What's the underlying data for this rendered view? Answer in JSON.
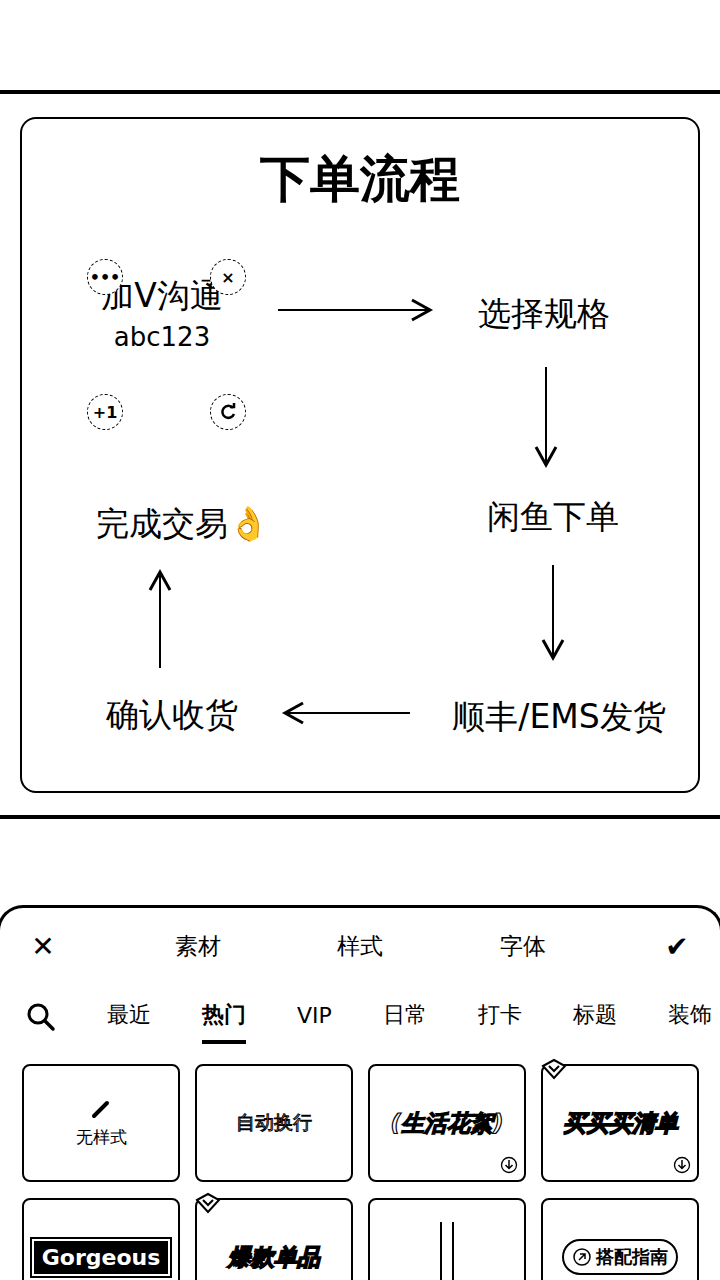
{
  "card": {
    "title": "下单流程",
    "nodes": [
      {
        "label": "加V沟通",
        "sub": "abc123",
        "selected": true
      },
      {
        "label": "选择规格",
        "selected": false
      },
      {
        "label": "闲鱼下单",
        "selected": false
      },
      {
        "label": "顺丰/EMS发货",
        "selected": false
      },
      {
        "label": "确认收货",
        "selected": false
      },
      {
        "label": "完成交易👌",
        "selected": false
      }
    ],
    "handles": [
      "•••",
      "×",
      "+1"
    ]
  },
  "toolbar": {
    "cancel": "✕",
    "tabs": [
      "素材",
      "样式",
      "字体"
    ],
    "confirm": "✔"
  },
  "categories": [
    {
      "label": "最近",
      "selected": false
    },
    {
      "label": "热门",
      "selected": true
    },
    {
      "label": "VIP",
      "selected": false
    },
    {
      "label": "日常",
      "selected": false
    },
    {
      "label": "打卡",
      "selected": false
    },
    {
      "label": "标题",
      "selected": false
    },
    {
      "label": "装饰",
      "selected": false
    }
  ],
  "styles": [
    {
      "label": "无样式",
      "kind": "none",
      "vip": false,
      "download": false
    },
    {
      "label": "自动换行",
      "kind": "outline",
      "vip": false,
      "download": false
    },
    {
      "label": "(生活花絮)",
      "kind": "italic",
      "vip": false,
      "download": true
    },
    {
      "label": "买买买清单",
      "kind": "heavy",
      "vip": true,
      "download": true
    },
    {
      "label": "Gorgeous",
      "kind": "boxed",
      "vip": false,
      "download": false
    },
    {
      "label": "爆款单品",
      "kind": "heavy",
      "vip": true,
      "download": false
    },
    {
      "label": "",
      "kind": "vertical",
      "vip": false,
      "download": false
    },
    {
      "label": "搭配指南",
      "kind": "pill",
      "vip": false,
      "download": false
    }
  ]
}
